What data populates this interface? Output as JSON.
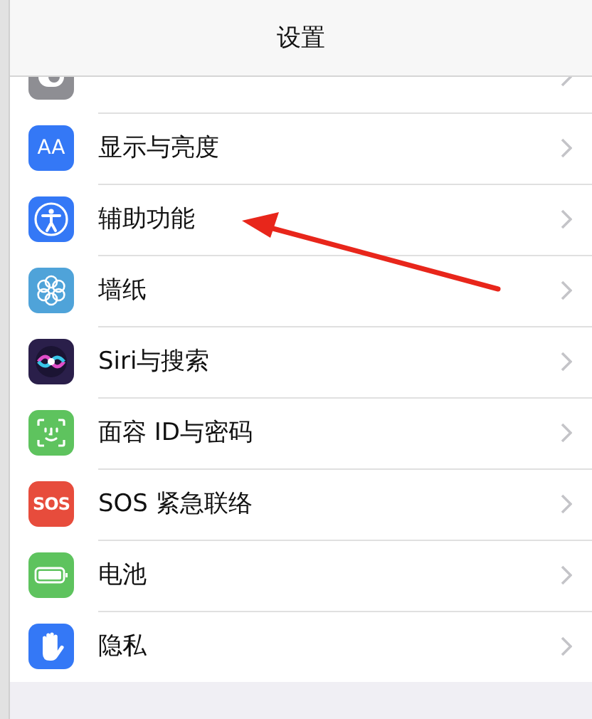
{
  "title": "设置",
  "items": [
    {
      "kind": "control",
      "cut": true
    },
    {
      "label": "显示与亮度",
      "kind": "display",
      "icon_text": "AA"
    },
    {
      "label": "辅助功能",
      "kind": "accessibility"
    },
    {
      "label": "墙纸",
      "kind": "wallpaper"
    },
    {
      "label": "Siri与搜索",
      "kind": "siri"
    },
    {
      "label": "面容 ID与密码",
      "kind": "faceid"
    },
    {
      "label": "SOS 紧急联络",
      "kind": "sos",
      "icon_text": "SOS"
    },
    {
      "label": "电池",
      "kind": "battery"
    },
    {
      "label": "隐私",
      "kind": "privacy"
    }
  ]
}
